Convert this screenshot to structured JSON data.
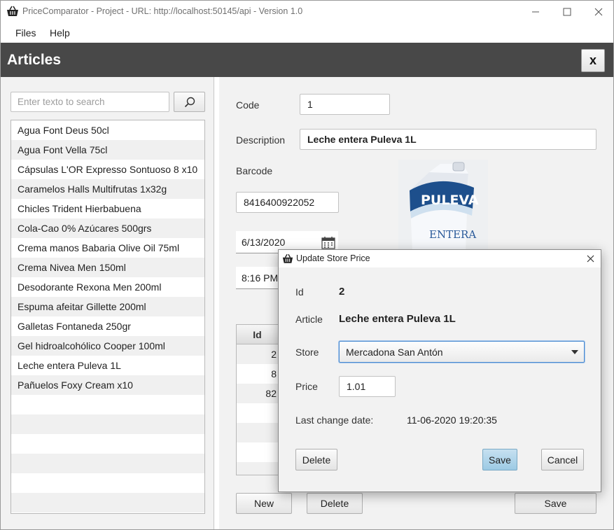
{
  "window": {
    "title": "PriceComparator - Project - URL: http://localhost:50145/api - Version 1.0"
  },
  "menu": {
    "files": "Files",
    "help": "Help"
  },
  "header": {
    "title": "Articles",
    "close_label": "x"
  },
  "search": {
    "placeholder": "Enter texto to search",
    "value": ""
  },
  "articles": [
    "Agua Font Deus 50cl",
    "Agua Font Vella 75cl",
    "Cápsulas L'OR Expresso Sontuoso 8 x10",
    "Caramelos Halls Multifrutas 1x32g",
    "Chicles Trident Hierbabuena",
    "Cola-Cao 0% Azúcares 500grs",
    "Crema manos Babaria Olive Oil 75ml",
    "Crema Nivea Men 150ml",
    "Desodorante Rexona Men 200ml",
    "Espuma afeitar Gillette 200ml",
    "Galletas Fontaneda 250gr",
    "Gel hidroalcohólico Cooper 100ml",
    "Leche entera Puleva 1L",
    "Pañuelos Foxy Cream x10",
    "",
    "",
    "",
    "",
    "",
    ""
  ],
  "detail": {
    "code_label": "Code",
    "code_value": "1",
    "description_label": "Description",
    "description_value": "Leche entera Puleva 1L",
    "barcode_label": "Barcode",
    "barcode_value": "8416400922052",
    "date_value": "6/13/2020",
    "time_value": "8:16 PM",
    "image_brand": "PULEVA",
    "image_variant": "ENTERA",
    "prices_header_id": "Id",
    "prices_ids": [
      "2",
      "8",
      "82",
      "",
      "",
      "",
      ""
    ],
    "new_button": "New",
    "delete_button": "Delete",
    "save_button": "Save"
  },
  "dialog": {
    "title": "Update Store Price",
    "id_label": "Id",
    "id_value": "2",
    "article_label": "Article",
    "article_value": "Leche entera Puleva 1L",
    "store_label": "Store",
    "store_value": "Mercadona San Antón",
    "price_label": "Price",
    "price_value": "1.01",
    "last_change_label": "Last change date:",
    "last_change_value": "11-06-2020 19:20:35",
    "delete_button": "Delete",
    "save_button": "Save",
    "cancel_button": "Cancel"
  }
}
